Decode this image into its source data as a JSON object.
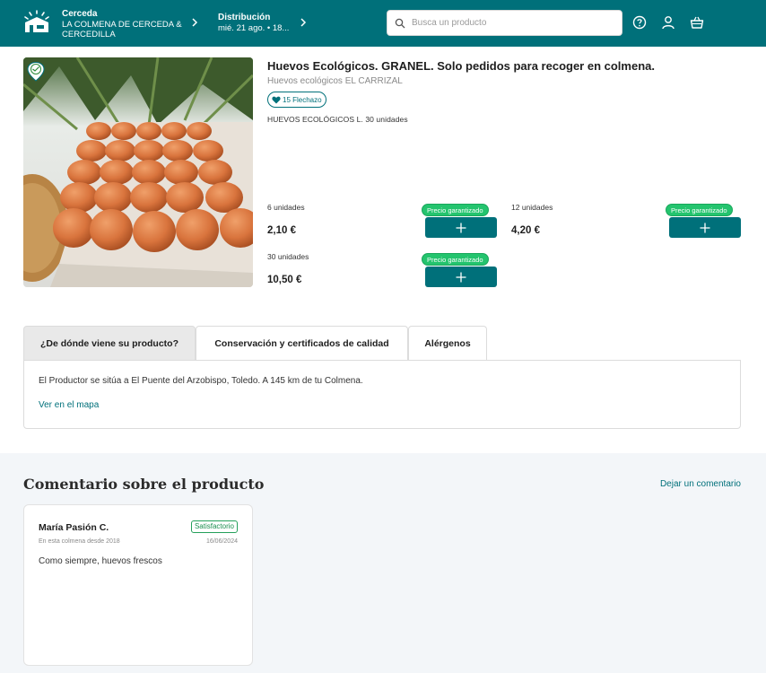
{
  "header": {
    "location_title": "Cerceda",
    "location_subtitle": "LA COLMENA DE CERCEDA & CERCEDILLA",
    "distribution_title": "Distribución",
    "distribution_date": "mié. 21 ago. • 18...",
    "search_placeholder": "Busca un producto",
    "icons": [
      "logo-hive-icon",
      "chevron-right-icon",
      "search-icon",
      "help-icon",
      "user-icon",
      "basket-icon"
    ]
  },
  "product": {
    "title": "Huevos Ecológicos. GRANEL. Solo pedidos para recoger en colmena.",
    "producer": "Huevos ecológicos EL CARRIZAL",
    "likes": "15 Flechazo",
    "description": "HUEVOS ECOLÓGICOS L. 30 unidades",
    "guarantee_label": "Precio garantizado",
    "options": [
      {
        "label": "6 unidades",
        "price": "2,10 €"
      },
      {
        "label": "12 unidades",
        "price": "4,20 €"
      },
      {
        "label": "30 unidades",
        "price": "10,50 €"
      }
    ]
  },
  "tabs": {
    "items": [
      {
        "label": "¿De dónde viene su producto?"
      },
      {
        "label": "Conservación y certificados de calidad"
      },
      {
        "label": "Alérgenos"
      }
    ],
    "active_text": "El Productor se sitúa a El Puente del Arzobispo, Toledo. A 145 km de tu Colmena.",
    "map_link": "Ver en el mapa"
  },
  "comments": {
    "title": "Comentario sobre el producto",
    "leave_comment": "Dejar un comentario",
    "items": [
      {
        "author": "María Pasión C.",
        "rating": "Satisfactorio",
        "member_since": "En esta colmena desde 2018",
        "date": "16/06/2024",
        "text": "Como siempre, huevos frescos"
      }
    ]
  },
  "colors": {
    "brand": "#00707a",
    "guarantee": "#24c46e",
    "background_soft": "#f3f6f9"
  }
}
